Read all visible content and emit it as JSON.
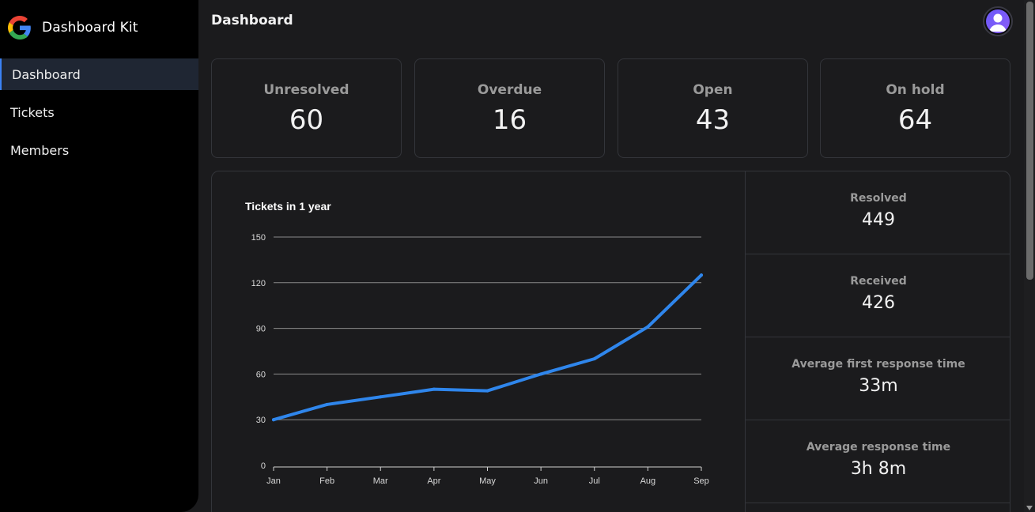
{
  "app": {
    "name": "Dashboard Kit",
    "logo_icon": "google-g-icon"
  },
  "sidebar": {
    "items": [
      {
        "label": "Dashboard",
        "active": true
      },
      {
        "label": "Tickets",
        "active": false
      },
      {
        "label": "Members",
        "active": false
      }
    ]
  },
  "header": {
    "title": "Dashboard",
    "avatar_icon": "user-avatar-icon"
  },
  "cards": [
    {
      "label": "Unresolved",
      "value": "60"
    },
    {
      "label": "Overdue",
      "value": "16"
    },
    {
      "label": "Open",
      "value": "43"
    },
    {
      "label": "On hold",
      "value": "64"
    }
  ],
  "stats": [
    {
      "label": "Resolved",
      "value": "449"
    },
    {
      "label": "Received",
      "value": "426"
    },
    {
      "label": "Average first response time",
      "value": "33m"
    },
    {
      "label": "Average response time",
      "value": "3h 8m"
    }
  ],
  "colors": {
    "accent": "#3b82f6",
    "line": "#2f86ec",
    "background": "#1b1b1d",
    "sidebar": "#000000"
  },
  "chart_data": {
    "type": "line",
    "title": "Tickets in 1 year",
    "xlabel": "",
    "ylabel": "",
    "categories": [
      "Jan",
      "Feb",
      "Mar",
      "Apr",
      "May",
      "Jun",
      "Jul",
      "Aug",
      "Sep"
    ],
    "series": [
      {
        "values": [
          30,
          40,
          45,
          50,
          49,
          60,
          70,
          91,
          125
        ]
      }
    ],
    "yticks": [
      "0",
      "30",
      "60",
      "90",
      "120",
      "150"
    ],
    "ylim": [
      0,
      150
    ],
    "grid": true,
    "legend": "none"
  }
}
